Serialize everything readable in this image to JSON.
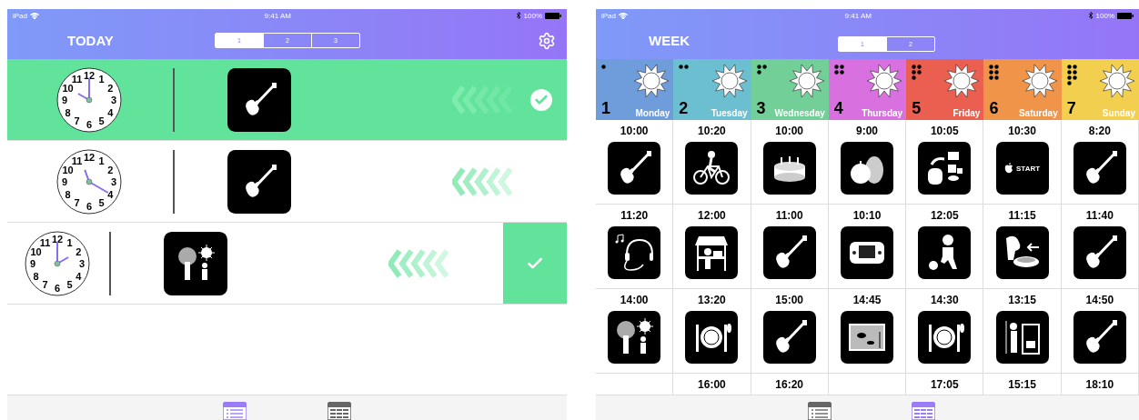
{
  "today": {
    "status_bar": {
      "device": "iPad",
      "time": "9:41 AM",
      "battery": "100%"
    },
    "title": "TODAY",
    "segments": [
      {
        "label": "1",
        "selected": true
      },
      {
        "label": "2",
        "selected": false
      },
      {
        "label": "3",
        "selected": false
      }
    ],
    "rows": [
      {
        "clock": {
          "kind": "h10m00",
          "numerals": [
            "11",
            "12",
            "1",
            "10",
            "2",
            "9",
            "3",
            "8",
            "4",
            "7",
            "6",
            "5"
          ]
        },
        "kind": "guitar",
        "done": true,
        "swiped": false
      },
      {
        "clock": {
          "kind": "h11m20",
          "numerals": [
            "11",
            "12",
            "1",
            "10",
            "2",
            "9",
            "3",
            "8",
            "4",
            "7",
            "6",
            "5"
          ]
        },
        "kind": "guitar",
        "done": false,
        "swiped": false
      },
      {
        "clock": {
          "kind": "h14m00",
          "numerals": [
            "11",
            "12",
            "1",
            "10",
            "2",
            "9",
            "3",
            "8",
            "4",
            "7",
            "6",
            "5"
          ]
        },
        "kind": "tree_sun",
        "done": false,
        "swiped": true
      }
    ],
    "tabs": [
      {
        "kind": "list",
        "selected": true
      },
      {
        "kind": "grid",
        "selected": false
      }
    ]
  },
  "week": {
    "status_bar": {
      "device": "iPad",
      "time": "9:41 AM",
      "battery": "100%"
    },
    "title": "WEEK",
    "segments": [
      {
        "label": "1",
        "selected": true
      },
      {
        "label": "2",
        "selected": false
      }
    ],
    "days": [
      {
        "number": "1",
        "name": "Monday",
        "color": "#6f9ddb",
        "events": [
          {
            "time": "10:00",
            "kind": "guitar"
          },
          {
            "time": "11:20",
            "kind": "headphones"
          },
          {
            "time": "14:00",
            "kind": "tree_sun"
          }
        ]
      },
      {
        "number": "2",
        "name": "Tuesday",
        "color": "#6cbfd0",
        "events": [
          {
            "time": "10:20",
            "kind": "bike"
          },
          {
            "time": "12:00",
            "kind": "shop"
          },
          {
            "time": "13:20",
            "kind": "meal"
          },
          {
            "time": "16:00"
          }
        ]
      },
      {
        "number": "3",
        "name": "Wednesday",
        "color": "#72cf97",
        "events": [
          {
            "time": "10:00",
            "kind": "cake"
          },
          {
            "time": "11:00",
            "kind": "guitar"
          },
          {
            "time": "15:00",
            "kind": "guitar"
          },
          {
            "time": "16:20"
          }
        ]
      },
      {
        "number": "4",
        "name": "Thursday",
        "color": "#d870df",
        "events": [
          {
            "time": "9:00",
            "kind": "fruit"
          },
          {
            "time": "10:10",
            "kind": "game"
          },
          {
            "time": "14:45",
            "kind": "aquarium"
          }
        ]
      },
      {
        "number": "5",
        "name": "Friday",
        "color": "#ea5f4f",
        "events": [
          {
            "time": "10:05",
            "kind": "packing"
          },
          {
            "time": "12:05",
            "kind": "football"
          },
          {
            "time": "14:30",
            "kind": "meal"
          },
          {
            "time": "17:05"
          }
        ]
      },
      {
        "number": "6",
        "name": "Saturday",
        "color": "#ef9448",
        "events": [
          {
            "time": "10:30",
            "kind": "start",
            "label": "START"
          },
          {
            "time": "11:15",
            "kind": "dog_bowl"
          },
          {
            "time": "13:15",
            "kind": "cooking"
          },
          {
            "time": "15:15"
          }
        ]
      },
      {
        "number": "7",
        "name": "Sunday",
        "color": "#f2cf4f",
        "events": [
          {
            "time": "8:20",
            "kind": "guitar"
          },
          {
            "time": "11:40",
            "kind": "guitar"
          },
          {
            "time": "14:50",
            "kind": "guitar"
          },
          {
            "time": "18:10"
          }
        ]
      }
    ],
    "tabs": [
      {
        "kind": "list",
        "selected": false
      },
      {
        "kind": "grid",
        "selected": true
      }
    ]
  }
}
